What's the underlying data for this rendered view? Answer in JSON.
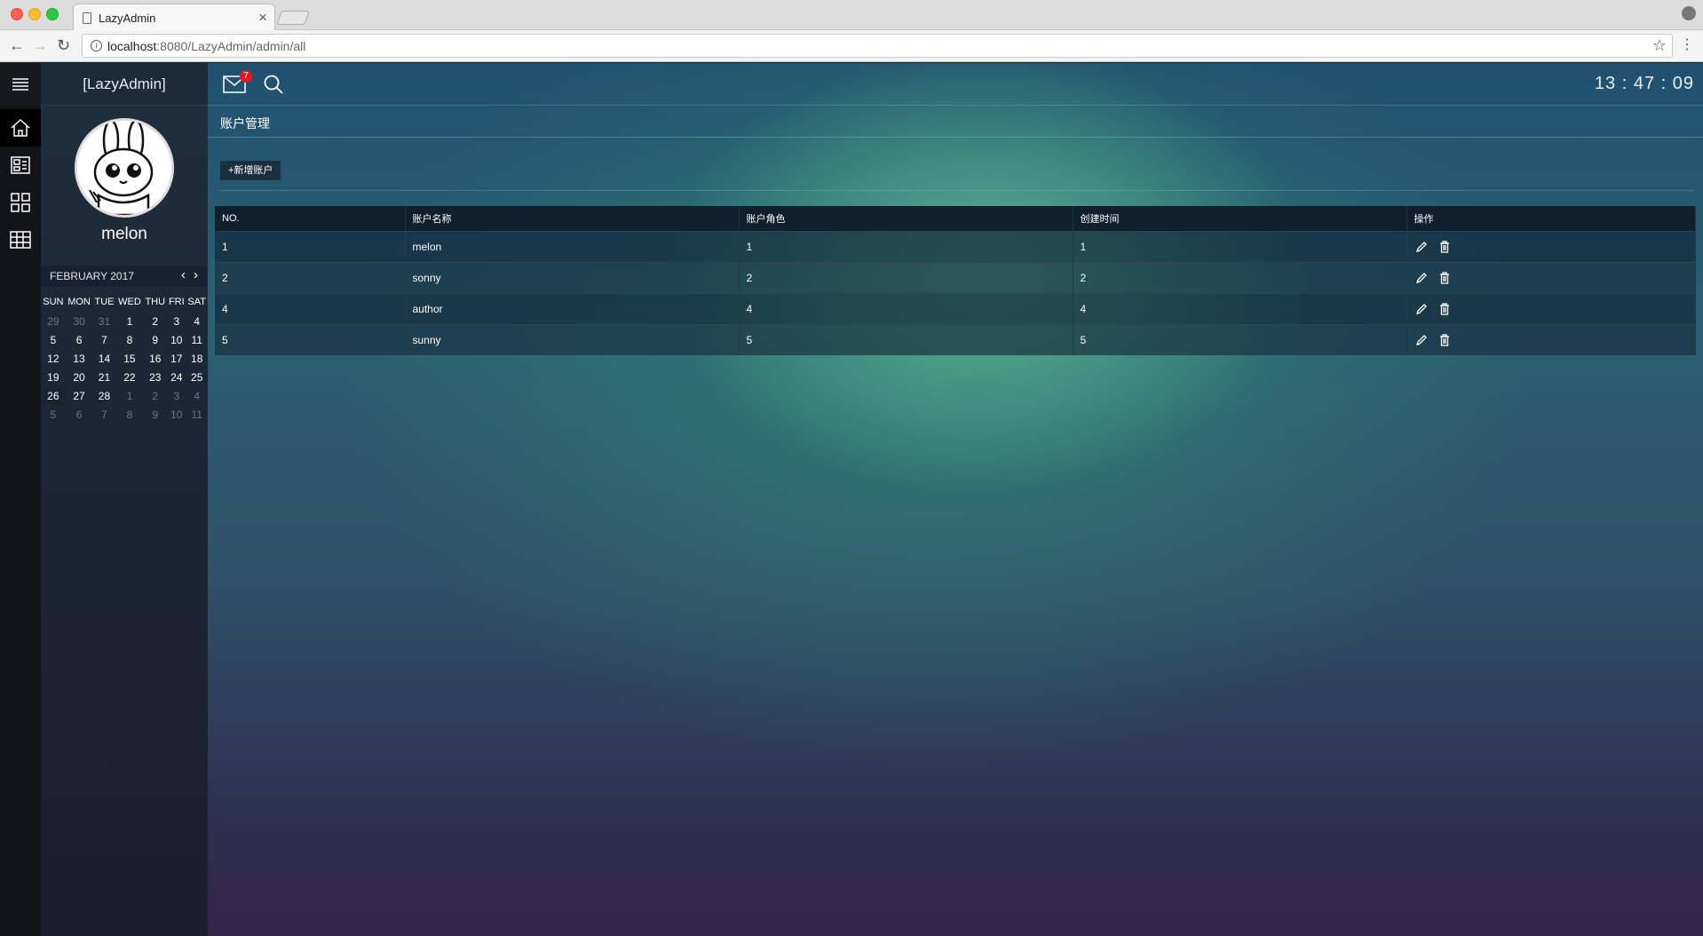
{
  "browser": {
    "tab_title": "LazyAdmin",
    "url_host": "localhost",
    "url_rest": ":8080/LazyAdmin/admin/all"
  },
  "app": {
    "brand": "[LazyAdmin]",
    "username": "melon",
    "mail_count": "7",
    "clock": "13 : 47 : 09",
    "page_title": "账户管理",
    "add_button_label": "+新增账户",
    "accent_color": "#1c2f3e"
  },
  "calendar": {
    "month_label": "FEBRUARY 2017",
    "weekdays": [
      "SUN",
      "MON",
      "TUE",
      "WED",
      "THU",
      "FRI",
      "SAT"
    ],
    "weeks": [
      [
        "29",
        "30",
        "31",
        "1",
        "2",
        "3",
        "4"
      ],
      [
        "5",
        "6",
        "7",
        "8",
        "9",
        "10",
        "11"
      ],
      [
        "12",
        "13",
        "14",
        "15",
        "16",
        "17",
        "18"
      ],
      [
        "19",
        "20",
        "21",
        "22",
        "23",
        "24",
        "25"
      ],
      [
        "26",
        "27",
        "28",
        "1",
        "2",
        "3",
        "4"
      ],
      [
        "5",
        "6",
        "7",
        "8",
        "9",
        "10",
        "11"
      ]
    ]
  },
  "table": {
    "headers": [
      "NO.",
      "账户名称",
      "账户角色",
      "创建时间",
      "操作"
    ],
    "rows": [
      {
        "no": "1",
        "name": "melon",
        "role": "1",
        "time": "1"
      },
      {
        "no": "2",
        "name": "sonny",
        "role": "2",
        "time": "2"
      },
      {
        "no": "4",
        "name": "author",
        "role": "4",
        "time": "4"
      },
      {
        "no": "5",
        "name": "sunny",
        "role": "5",
        "time": "5"
      }
    ]
  },
  "icons": {
    "sidebar": [
      "menu-icon",
      "home-icon",
      "dashboard-icon",
      "grid-icon",
      "table-icon"
    ],
    "row_actions": [
      "edit-icon",
      "delete-icon"
    ]
  }
}
